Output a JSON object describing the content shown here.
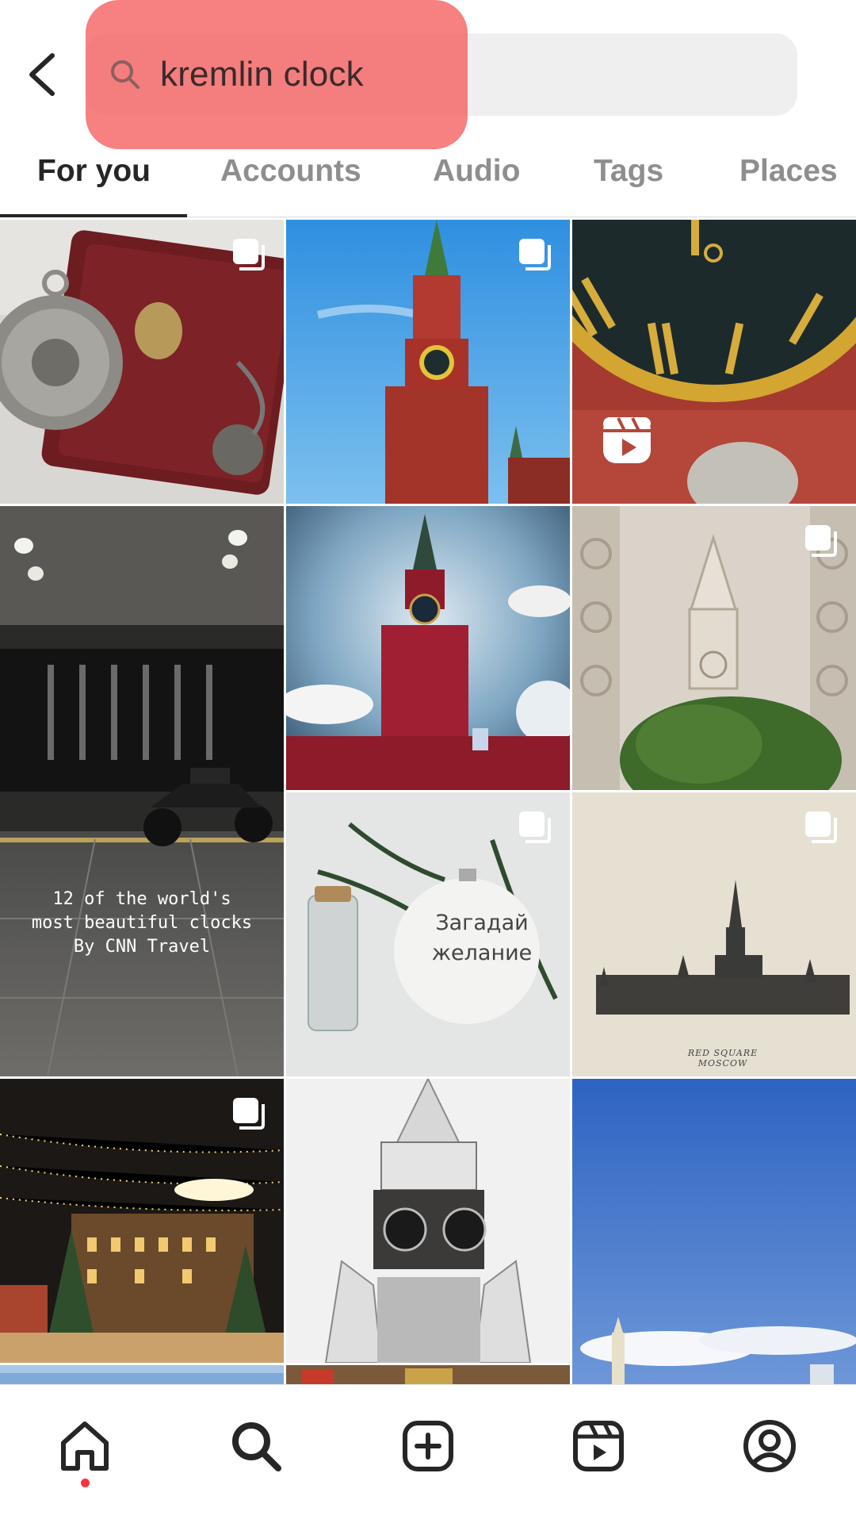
{
  "search": {
    "query": "kremlin clock"
  },
  "tabs": [
    {
      "label": "For you",
      "active": true
    },
    {
      "label": "Accounts",
      "active": false
    },
    {
      "label": "Audio",
      "active": false
    },
    {
      "label": "Tags",
      "active": false
    },
    {
      "label": "Places",
      "active": false
    }
  ],
  "grid": {
    "tiles": [
      {
        "subject": "pocket watch with red leather cover",
        "badge": "carousel-icon"
      },
      {
        "subject": "Spasskaya Tower against blue sky",
        "badge": "carousel-icon"
      },
      {
        "subject": "close-up of clock face with gold numerals",
        "badge": "reels-icon"
      },
      {
        "subject": "dark hall with motorcycle",
        "badge": "reels-icon",
        "caption": "12 of the world's\nmost beautiful clocks\nBy CNN Travel"
      },
      {
        "subject": "red Kremlin tower with clouds",
        "badge": null
      },
      {
        "subject": "stone relief of Kremlin tower with tree",
        "badge": "carousel-icon"
      },
      {
        "subject": "Christmas ornament with fir branch",
        "badge": "carousel-icon",
        "ornament_text": "Загадай\nжелание"
      },
      {
        "subject": "sketch of Kremlin on beige paper",
        "badge": "carousel-icon",
        "sketch_text": "RED SQUARE\nMOSCOW"
      },
      {
        "subject": "night market with lights",
        "badge": "carousel-icon"
      },
      {
        "subject": "beaded tower clock sculpture",
        "badge": null
      },
      {
        "subject": "blue sky over city skyline",
        "badge": null
      }
    ]
  },
  "bottom_nav": {
    "items": [
      {
        "icon": "home-icon",
        "active": true
      },
      {
        "icon": "search-icon",
        "active": false
      },
      {
        "icon": "create-post-icon",
        "active": false
      },
      {
        "icon": "reels-icon",
        "active": false
      },
      {
        "icon": "profile-icon",
        "active": false
      }
    ],
    "notification_dot_color": "#ff3040"
  },
  "colors": {
    "highlight": "#f55c5c",
    "search_background": "#efefef",
    "active_tab": "#262626",
    "inactive_tab": "#8e8e8e"
  }
}
